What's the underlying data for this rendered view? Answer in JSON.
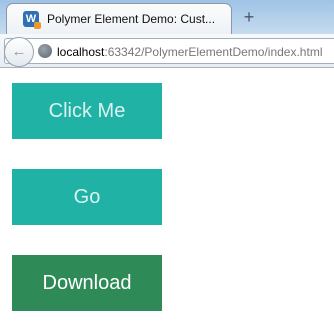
{
  "browser": {
    "tab_title": "Polymer Element Demo: Cust...",
    "favicon_letter": "W",
    "new_tab_symbol": "+",
    "back_symbol": "←",
    "url_host": "localhost",
    "url_rest": ":63342/PolymerElementDemo/index.html"
  },
  "page": {
    "buttons": [
      {
        "label": "Click Me",
        "color": "#1fb2a5",
        "text_color": "#daf3f0"
      },
      {
        "label": "Go",
        "color": "#1fb2a5",
        "text_color": "#daf3f0"
      },
      {
        "label": "Download",
        "color": "#2e8b57",
        "text_color": "#ffffff"
      }
    ]
  }
}
